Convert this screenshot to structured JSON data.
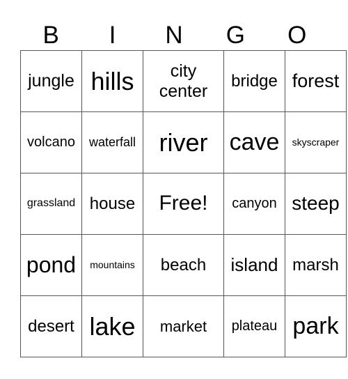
{
  "header": [
    "B",
    "I",
    "N",
    "G",
    "O"
  ],
  "rows": [
    [
      "jungle",
      "hills",
      "city center",
      "bridge",
      "forest"
    ],
    [
      "volcano",
      "waterfall",
      "river",
      "cave",
      "skyscraper"
    ],
    [
      "grassland",
      "house",
      "Free!",
      "canyon",
      "steep"
    ],
    [
      "pond",
      "mountains",
      "beach",
      "island",
      "marsh"
    ],
    [
      "desert",
      "lake",
      "market",
      "plateau",
      "park"
    ]
  ]
}
